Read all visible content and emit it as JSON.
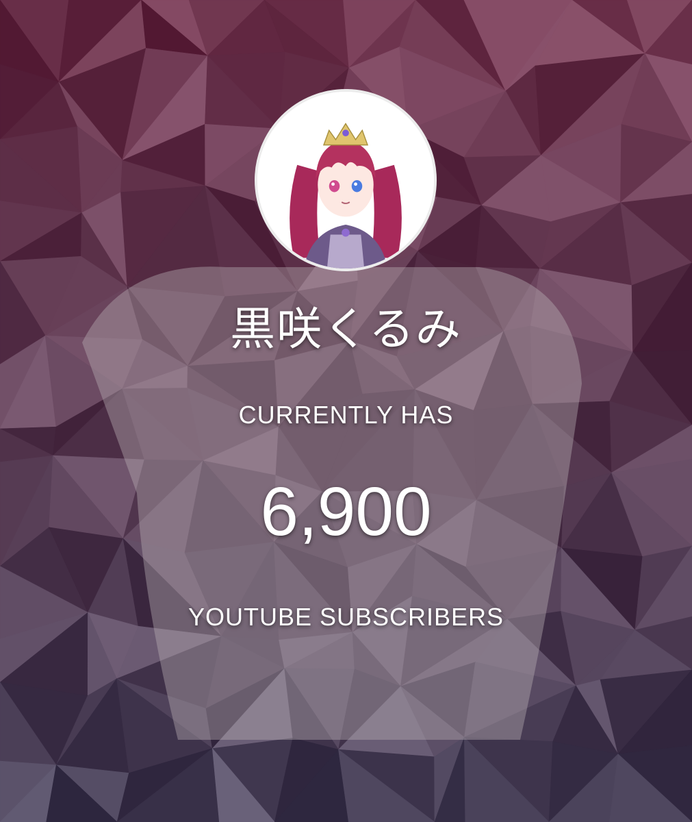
{
  "profile": {
    "channel_name": "黒咲くるみ",
    "currently_label": "CURRENTLY HAS",
    "subscriber_count": "6,900",
    "subscribers_label": "YOUTUBE SUBSCRIBERS"
  },
  "colors": {
    "background_base": "#5a3d4c",
    "text": "#ffffff",
    "avatar_ring": "#ececec",
    "hair": "#b4325f"
  }
}
